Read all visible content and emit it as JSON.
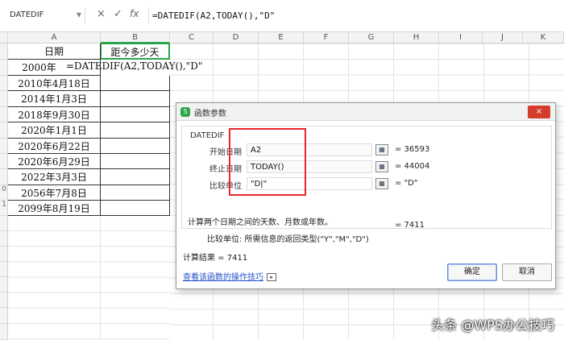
{
  "formula_bar": {
    "name_box": "DATEDIF",
    "cancel_glyph": "×",
    "confirm_glyph": "✓",
    "fx_glyph": "fx",
    "formula": "=DATEDIF(A2,TODAY(),\"D\""
  },
  "columns": [
    "A",
    "B",
    "C",
    "D",
    "E",
    "F",
    "G",
    "H",
    "I",
    "J",
    "K"
  ],
  "rows": [
    "",
    "",
    "",
    "",
    "",
    "",
    "",
    "",
    "",
    "0",
    "1",
    "",
    "",
    "",
    "",
    "",
    "",
    "",
    "",
    "",
    ""
  ],
  "sheet": {
    "header_a": "日期",
    "header_b": "距今多少天",
    "a2": "2000年",
    "b2_formula": "=DATEDIF(A2,TODAY(),\"D\"",
    "dates": [
      "2010年4月18日",
      "2014年1月3日",
      "2018年9月30日",
      "2020年1月1日",
      "2020年6月22日",
      "2020年6月29日",
      "2022年3月3日",
      "2056年7月8日",
      "2099年8月19日"
    ]
  },
  "dialog": {
    "title": "函数参数",
    "close_glyph": "×",
    "function_name": "DATEDIF",
    "args": [
      {
        "label": "开始日期",
        "value": "A2",
        "result": "=  36593"
      },
      {
        "label": "终止日期",
        "value": "TODAY()",
        "result": "=  44004"
      },
      {
        "label": "比较单位",
        "value": "\"D|\"",
        "result": "=  \"D\""
      }
    ],
    "total": "=  7411",
    "description": "计算两个日期之间的天数、月数或年数。",
    "arg_help": "比较单位:  所需信息的返回类型(\"Y\",\"M\",\"D\")",
    "result_line": "计算结果  =  7411",
    "help_link": "查看该函数的操作技巧",
    "ok": "确定",
    "cancel": "取消"
  },
  "watermark": "头条 @WPS办公技巧",
  "colors": {
    "highlight": "#e8262d",
    "accent": "#2aa54b",
    "link": "#2451c9"
  }
}
